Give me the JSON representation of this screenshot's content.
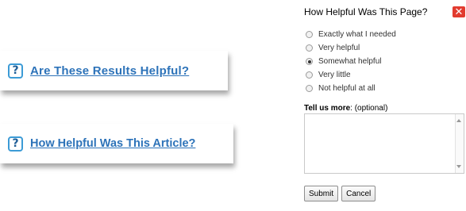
{
  "cards": [
    {
      "icon": "?",
      "link_text": "Are These Results Helpful?"
    },
    {
      "icon": "?",
      "link_text": "How Helpful Was This Article?"
    }
  ],
  "dialog": {
    "title": "How Helpful Was This Page?",
    "close_glyph": "✕",
    "options": [
      {
        "label": "Exactly what I needed",
        "checked": false
      },
      {
        "label": "Very helpful",
        "checked": false
      },
      {
        "label": "Somewhat helpful",
        "checked": true
      },
      {
        "label": "Very little",
        "checked": false
      },
      {
        "label": "Not helpful at all",
        "checked": false
      }
    ],
    "more_label": "Tell us more",
    "more_suffix": ": (optional)",
    "comment_value": "",
    "submit_label": "Submit",
    "cancel_label": "Cancel"
  },
  "colors": {
    "link": "#2d73b9",
    "icon_border": "#3c9bd6",
    "close_bg": "#e23b2f"
  }
}
